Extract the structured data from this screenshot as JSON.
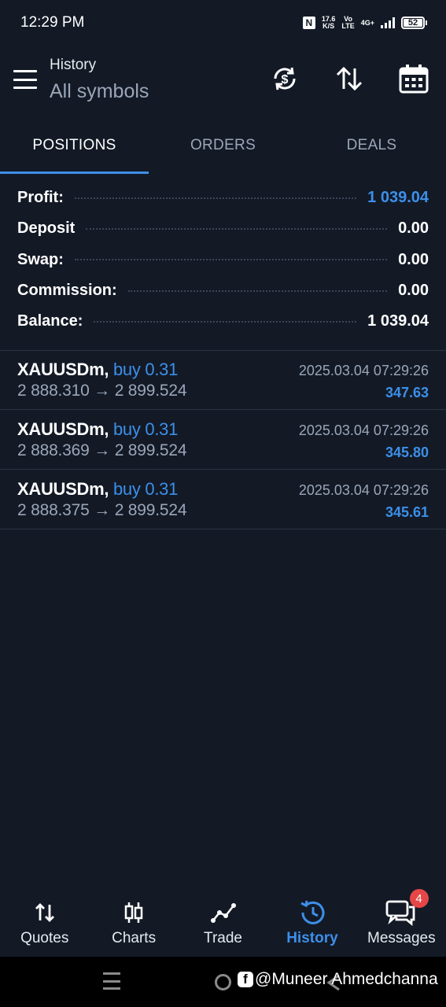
{
  "status_bar": {
    "time": "12:29 PM",
    "speed_top": "17.6",
    "speed_bottom": "K/S",
    "volte_top": "Vo",
    "volte_bottom": "LTE",
    "network": "4G+",
    "battery": "52"
  },
  "header": {
    "title": "History",
    "subtitle": "All symbols"
  },
  "tabs": [
    {
      "label": "POSITIONS",
      "active": true
    },
    {
      "label": "ORDERS",
      "active": false
    },
    {
      "label": "DEALS",
      "active": false
    }
  ],
  "summary": {
    "profit_label": "Profit:",
    "profit_value": "1 039.04",
    "deposit_label": "Deposit",
    "deposit_value": "0.00",
    "swap_label": "Swap:",
    "swap_value": "0.00",
    "commission_label": "Commission:",
    "commission_value": "0.00",
    "balance_label": "Balance:",
    "balance_value": "1 039.04"
  },
  "positions": [
    {
      "symbol": "XAUUSDm,",
      "type": "buy 0.31",
      "prices": "2 888.310 → 2 899.524",
      "date": "2025.03.04 07:29:26",
      "profit": "347.63"
    },
    {
      "symbol": "XAUUSDm,",
      "type": "buy 0.31",
      "prices": "2 888.369 → 2 899.524",
      "date": "2025.03.04 07:29:26",
      "profit": "345.80"
    },
    {
      "symbol": "XAUUSDm,",
      "type": "buy 0.31",
      "prices": "2 888.375 → 2 899.524",
      "date": "2025.03.04 07:29:26",
      "profit": "345.61"
    }
  ],
  "bottom_nav": {
    "quotes": "Quotes",
    "charts": "Charts",
    "trade": "Trade",
    "history": "History",
    "messages": "Messages",
    "messages_badge": "4"
  },
  "watermark": "@Muneer Ahmedchanna",
  "colors": {
    "background": "#131a26",
    "accent": "#3d8fe9",
    "muted": "#9aa6b8",
    "badge": "#e54646"
  }
}
